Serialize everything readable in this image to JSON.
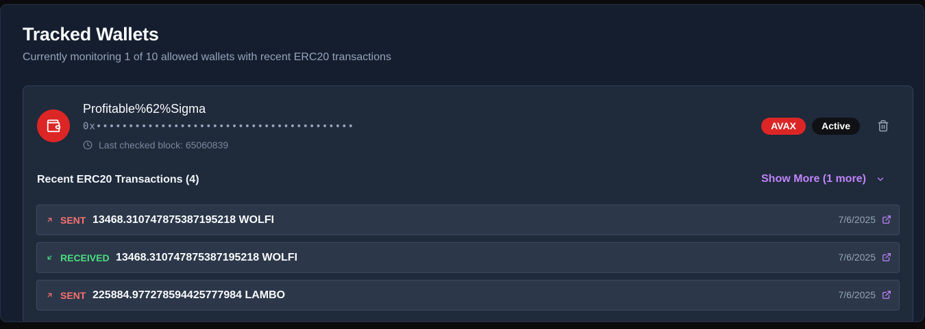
{
  "header": {
    "title": "Tracked Wallets",
    "subtitle": "Currently monitoring 1 of 10 allowed wallets with recent ERC20 transactions"
  },
  "wallet": {
    "name": "Profitable%62%Sigma",
    "address_masked": "0x••••••••••••••••••••••••••••••••••••••••",
    "last_checked_label": "Last checked block: 65060839",
    "chain_badge": "AVAX",
    "status_badge": "Active",
    "icon": "wallet-icon",
    "colors": {
      "accent": "#dc2626",
      "link": "#c084fc",
      "sent": "#f87171",
      "received": "#4ade80"
    }
  },
  "transactions": {
    "heading": "Recent ERC20 Transactions (4)",
    "show_more": "Show More (1 more)",
    "rows": [
      {
        "direction": "SENT",
        "amount": "13468.310747875387195218 WOLFI",
        "date": "7/6/2025"
      },
      {
        "direction": "RECEIVED",
        "amount": "13468.310747875387195218 WOLFI",
        "date": "7/6/2025"
      },
      {
        "direction": "SENT",
        "amount": "225884.977278594425777984 LAMBO",
        "date": "7/6/2025"
      }
    ]
  }
}
